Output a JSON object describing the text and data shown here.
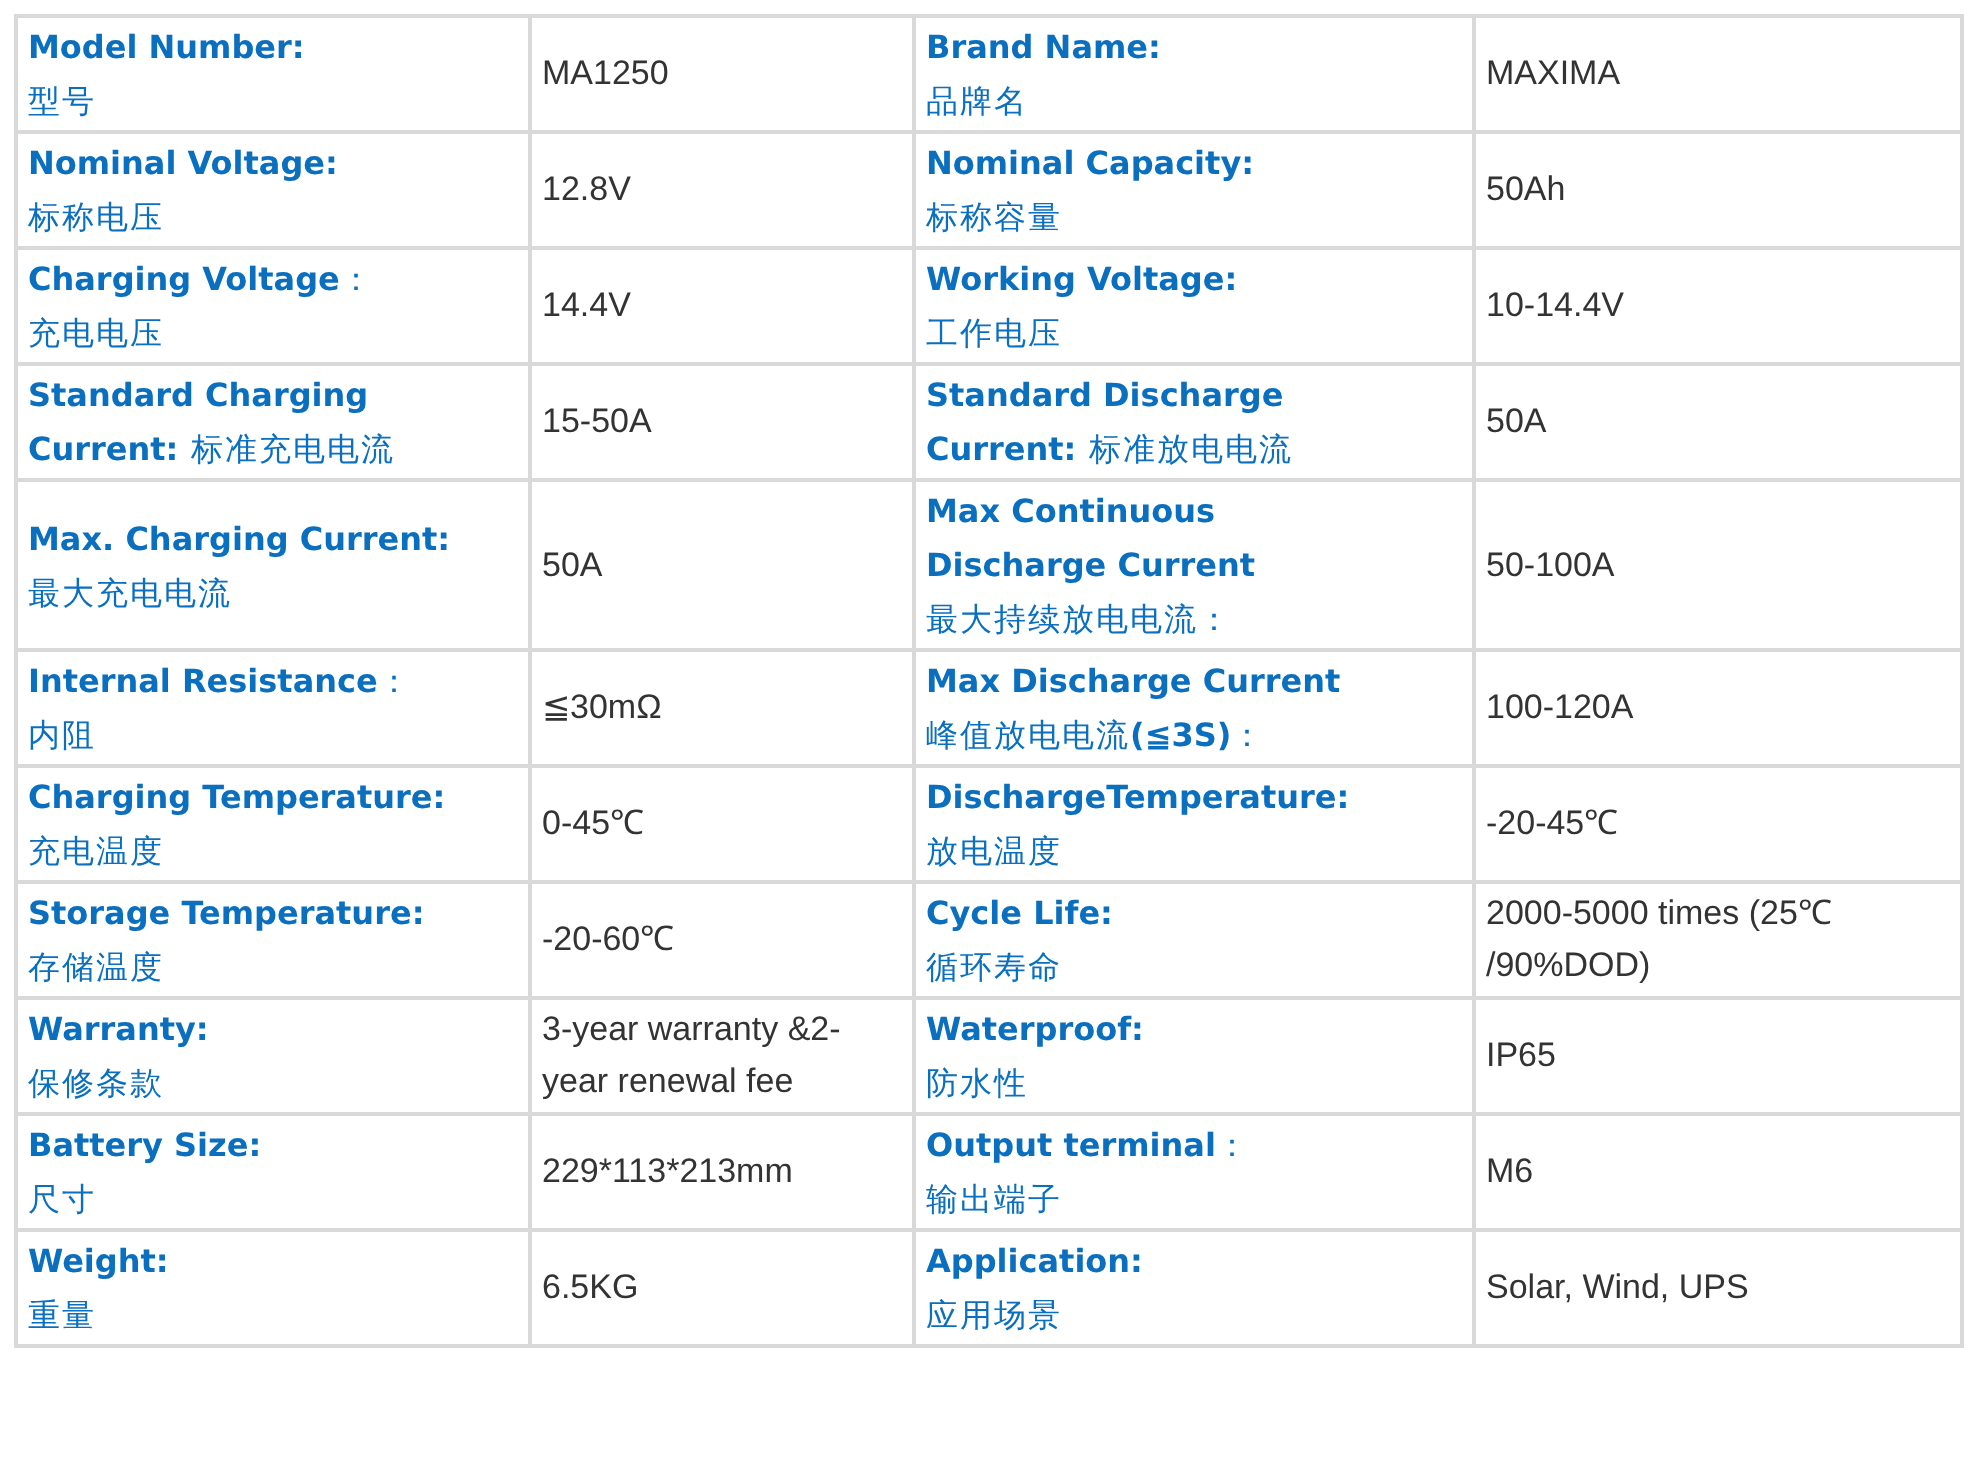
{
  "spec_table": {
    "rows": [
      {
        "pairs": [
          {
            "label": [
              {
                "kind": "en",
                "text": "Model Number:"
              },
              {
                "kind": "zh",
                "text": "型号"
              }
            ],
            "value": "MA1250"
          },
          {
            "label": [
              {
                "kind": "en",
                "text": "Brand Name:"
              },
              {
                "kind": "zh",
                "text": "品牌名"
              }
            ],
            "value": "MAXIMA"
          }
        ]
      },
      {
        "pairs": [
          {
            "label": [
              {
                "kind": "en",
                "text": "Nominal Voltage:"
              },
              {
                "kind": "zh",
                "text": "标称电压"
              }
            ],
            "value": "12.8V"
          },
          {
            "label": [
              {
                "kind": "en",
                "text": "Nominal Capacity:"
              },
              {
                "kind": "zh",
                "text": "标称容量"
              }
            ],
            "value": "50Ah"
          }
        ]
      },
      {
        "pairs": [
          {
            "label": [
              {
                "kind": "mixed",
                "text": "**Charging Voltage**："
              },
              {
                "kind": "zh",
                "text": "充电电压"
              }
            ],
            "value": "14.4V"
          },
          {
            "label": [
              {
                "kind": "en",
                "text": "Working Voltage:"
              },
              {
                "kind": "zh",
                "text": "工作电压"
              }
            ],
            "value": "10-14.4V"
          }
        ]
      },
      {
        "pairs": [
          {
            "label": [
              {
                "kind": "en",
                "text": "Standard Charging"
              },
              {
                "kind": "mixed",
                "text": "**Current:** 标准充电电流"
              }
            ],
            "value": "15-50A"
          },
          {
            "label": [
              {
                "kind": "en",
                "text": "Standard Discharge"
              },
              {
                "kind": "mixed",
                "text": "**Current:** 标准放电电流"
              }
            ],
            "value": "50A"
          }
        ]
      },
      {
        "pairs": [
          {
            "label": [
              {
                "kind": "en",
                "text": "Max. Charging Current:"
              },
              {
                "kind": "zh",
                "text": "最大充电电流"
              }
            ],
            "value": "50A"
          },
          {
            "label": [
              {
                "kind": "en",
                "text": "Max Continuous"
              },
              {
                "kind": "en",
                "text": "Discharge Current"
              },
              {
                "kind": "zh",
                "text": "最大持续放电电流："
              }
            ],
            "value": "50-100A"
          }
        ]
      },
      {
        "pairs": [
          {
            "label": [
              {
                "kind": "mixed",
                "text": "**Internal Resistance**："
              },
              {
                "kind": "zh",
                "text": "内阻"
              }
            ],
            "value": "≦30mΩ"
          },
          {
            "label": [
              {
                "kind": "en",
                "text": "Max Discharge Current"
              },
              {
                "kind": "mixed",
                "text": "峰值放电电流**(≦3S)**："
              }
            ],
            "value": "100-120A"
          }
        ]
      },
      {
        "pairs": [
          {
            "label": [
              {
                "kind": "en",
                "text": "Charging Temperature:"
              },
              {
                "kind": "zh",
                "text": "充电温度"
              }
            ],
            "value": "0-45℃"
          },
          {
            "label": [
              {
                "kind": "en",
                "text": "DischargeTemperature:"
              },
              {
                "kind": "zh",
                "text": "放电温度"
              }
            ],
            "value": "-20-45℃"
          }
        ]
      },
      {
        "pairs": [
          {
            "label": [
              {
                "kind": "en",
                "text": "Storage Temperature:"
              },
              {
                "kind": "zh",
                "text": "存储温度"
              }
            ],
            "value": "-20-60℃"
          },
          {
            "label": [
              {
                "kind": "en",
                "text": "Cycle Life:"
              },
              {
                "kind": "zh",
                "text": "循环寿命"
              }
            ],
            "value": "2000-5000 times (25℃\n/90%DOD)"
          }
        ]
      },
      {
        "pairs": [
          {
            "label": [
              {
                "kind": "en",
                "text": "Warranty:"
              },
              {
                "kind": "zh",
                "text": "保修条款"
              }
            ],
            "value": "3-year warranty &2-\nyear renewal fee"
          },
          {
            "label": [
              {
                "kind": "en",
                "text": "Waterproof:"
              },
              {
                "kind": "zh",
                "text": "防水性"
              }
            ],
            "value": "IP65"
          }
        ]
      },
      {
        "pairs": [
          {
            "label": [
              {
                "kind": "en",
                "text": "Battery Size:"
              },
              {
                "kind": "zh",
                "text": "尺寸"
              }
            ],
            "value": "229*113*213mm"
          },
          {
            "label": [
              {
                "kind": "mixed",
                "text": "**Output terminal**："
              },
              {
                "kind": "zh",
                "text": "输出端子"
              }
            ],
            "value": "M6"
          }
        ]
      },
      {
        "pairs": [
          {
            "label": [
              {
                "kind": "en",
                "text": "Weight:"
              },
              {
                "kind": "zh",
                "text": "重量"
              }
            ],
            "value": "6.5KG"
          },
          {
            "label": [
              {
                "kind": "en",
                "text": "Application:"
              },
              {
                "kind": "zh",
                "text": "应用场景"
              }
            ],
            "value": "Solar, Wind, UPS"
          }
        ]
      }
    ]
  }
}
